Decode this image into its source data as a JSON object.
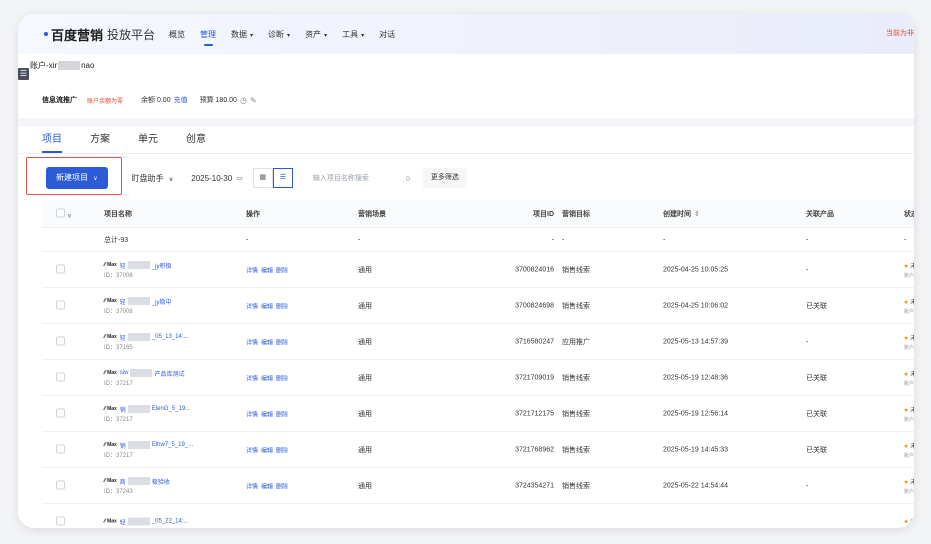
{
  "brand": {
    "name": "百度营销",
    "subtitle": "投放平台"
  },
  "nav": [
    {
      "label": "概览",
      "has_caret": false
    },
    {
      "label": "管理",
      "has_caret": false,
      "active": true
    },
    {
      "label": "数据",
      "has_caret": true
    },
    {
      "label": "诊断",
      "has_caret": true
    },
    {
      "label": "资产",
      "has_caret": true
    },
    {
      "label": "工具",
      "has_caret": true
    },
    {
      "label": "对话",
      "has_caret": false
    }
  ],
  "top_right_notice": "当前为非",
  "account": {
    "prefix": "账户-xir",
    "suffix": "nao"
  },
  "infobar": {
    "title": "信息流推广",
    "warning": "账户余额为零",
    "balance_label": "余额 0.00",
    "recharge": "充值",
    "budget_label": "预算 180.00"
  },
  "tabs": [
    "项目",
    "方案",
    "单元",
    "创意"
  ],
  "toolbar": {
    "new_project": "新建项目",
    "assistant": "盯盘助手",
    "date": "2025-10-30",
    "search_placeholder": "输入项目名称搜索",
    "more_filter": "更多筛选"
  },
  "table": {
    "headers": {
      "name": "项目名称",
      "op": "操作",
      "scene": "营销场景",
      "id": "项目ID",
      "goal": "营销目标",
      "time": "创建时间",
      "prod": "关联产品",
      "status": "状态"
    },
    "total": {
      "name": "总计-93",
      "op": "-",
      "scene": "-",
      "id": "-",
      "goal": "-",
      "time": "-",
      "prod": "-",
      "status": "-"
    },
    "op_links": [
      "详情",
      "编辑",
      "删除"
    ],
    "rows": [
      {
        "tag": "Max",
        "name_a": "轻",
        "name_b": "_jy积极",
        "id_label": "ID：37008",
        "scene": "通用",
        "id": "3700824016",
        "goal": "销售线索",
        "time": "2025-04-25 10:05:25",
        "prod": "-",
        "status": "未投",
        "status_sub": "账户余"
      },
      {
        "tag": "Max",
        "name_a": "轻",
        "name_b": "_jy稳中",
        "id_label": "ID：37008",
        "scene": "通用",
        "id": "3700824698",
        "goal": "销售线索",
        "time": "2025-04-25 10:06:02",
        "prod": "已关联",
        "status": "未投",
        "status_sub": "账户余"
      },
      {
        "tag": "Max",
        "name_a": "轻",
        "name_b": "_05_13_14:...",
        "id_label": "ID：37165",
        "scene": "通用",
        "id": "3716580247",
        "goal": "应用推广",
        "time": "2025-05-13 14:57:39",
        "prod": "-",
        "status": "未投",
        "status_sub": "账户余"
      },
      {
        "tag": "Max",
        "name_a": "siw",
        "name_b": "产品库测试",
        "id_label": "ID：37217",
        "scene": "通用",
        "id": "3721709019",
        "goal": "销售线索",
        "time": "2025-05-19 12:48:36",
        "prod": "已关联",
        "status": "未投",
        "status_sub": "账户余"
      },
      {
        "tag": "Max",
        "name_a": "销",
        "name_b": "ElenG_5_19...",
        "id_label": "ID：37217",
        "scene": "通用",
        "id": "3721712175",
        "goal": "销售线索",
        "time": "2025-05-19 12:56:14",
        "prod": "已关联",
        "status": "未投",
        "status_sub": "账户余"
      },
      {
        "tag": "Max",
        "name_a": "销",
        "name_b": "Elhw7_5_19_...",
        "id_label": "ID：37217",
        "scene": "通用",
        "id": "3721768962",
        "goal": "销售线索",
        "time": "2025-05-19 14:45:33",
        "prod": "已关联",
        "status": "未投",
        "status_sub": "账户余"
      },
      {
        "tag": "Max",
        "name_a": "商",
        "name_b": "极验收",
        "id_label": "ID：37243",
        "scene": "通用",
        "id": "3724354271",
        "goal": "销售线索",
        "time": "2025-05-22 14:54:44",
        "prod": "-",
        "status": "未投",
        "status_sub": "账户余"
      },
      {
        "tag": "Max",
        "name_a": "轻",
        "name_b": "_05_22_14:...",
        "id_label": "",
        "scene": "",
        "id": "",
        "goal": "",
        "time": "",
        "prod": "",
        "status": "未",
        "status_sub": ""
      }
    ]
  },
  "colors": {
    "accent": "#2b5bd7",
    "warning": "#e24b2f",
    "status_dot": "#f0a020",
    "highlight_box": "#e0524a"
  }
}
